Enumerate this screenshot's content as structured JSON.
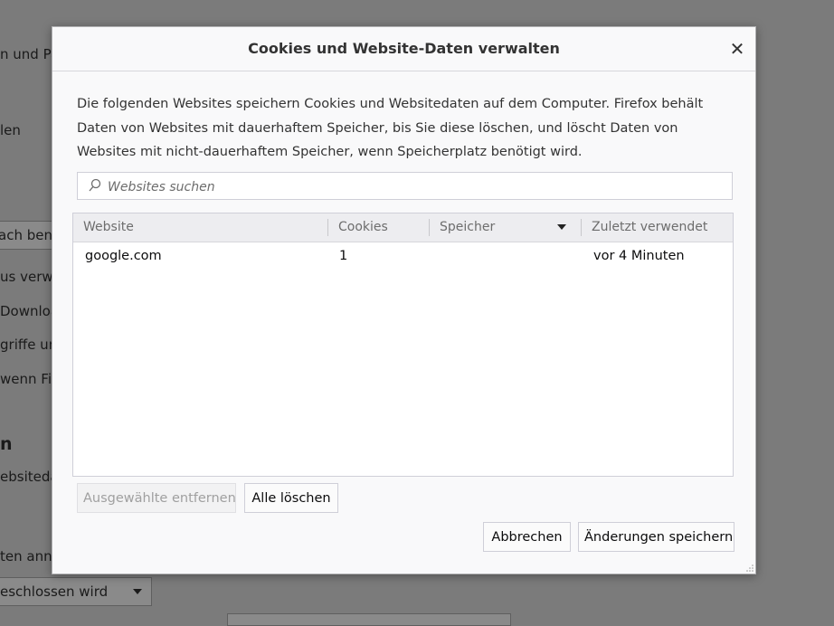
{
  "background": {
    "fragments": [
      "n und Pas",
      "len",
      "ach benu",
      "us verwe",
      "Downloa",
      "griffe un",
      "wenn Fir",
      "ebsiteda",
      "ten anne"
    ],
    "heading": "n",
    "select_value": "eschlossen wird"
  },
  "dialog": {
    "title": "Cookies und Website-Daten verwalten",
    "close_icon": "close-icon",
    "description": "Die folgenden Websites speichern Cookies und Websitedaten auf dem Computer. Firefox behält Daten von Websites mit dauerhaftem Speicher, bis Sie diese löschen, und löscht Daten von Websites mit nicht-dauerhaftem Speicher, wenn Speicherplatz benötigt wird.",
    "search": {
      "placeholder": "Websites suchen",
      "value": ""
    },
    "table": {
      "columns": [
        "Website",
        "Cookies",
        "Speicher",
        "Zuletzt verwendet"
      ],
      "sorted_column": "Speicher",
      "rows": [
        {
          "website": "google.com",
          "cookies": "1",
          "storage": "",
          "last_used": "vor 4 Minuten"
        }
      ]
    },
    "buttons": {
      "remove_selected": "Ausgewählte entfernen",
      "remove_all": "Alle löschen",
      "cancel": "Abbrechen",
      "save": "Änderungen speichern"
    }
  }
}
